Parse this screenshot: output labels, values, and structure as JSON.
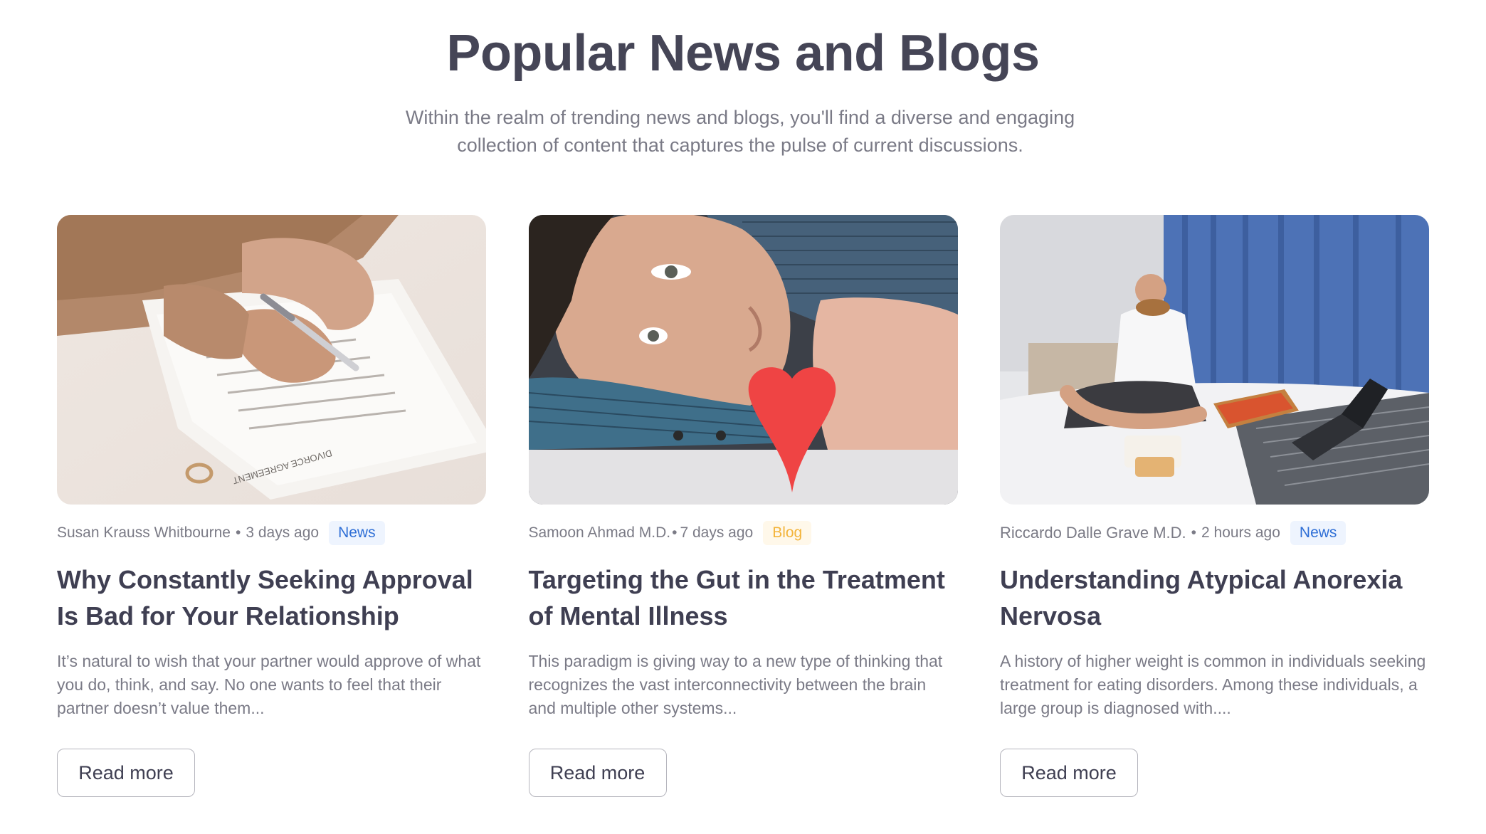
{
  "section": {
    "heading": "Popular News and Blogs",
    "subtitle_line1": "Within the realm of trending news and blogs, you'll find a diverse and engaging",
    "subtitle_line2": "collection of content that captures the pulse of current discussions."
  },
  "cards": [
    {
      "author": "Susan Krauss Whitbourne",
      "separator": "•",
      "time": "3 days ago",
      "category": "News",
      "title": "Why Constantly Seeking Approval Is Bad for Your Relationship",
      "excerpt": "It’s natural to wish that your partner would approve of what you do, think, and say. No one wants to feel that their partner doesn’t value them...",
      "button": "Read more",
      "image_text": "DIVORCE AGREEMENT"
    },
    {
      "author": "Samoon Ahmad M.D.",
      "separator": "•",
      "time": "7 days ago",
      "category": "Blog",
      "title": "Targeting the Gut in the Treatment of Mental Illness",
      "excerpt": "This paradigm is giving way to a new type of thinking that recognizes the vast interconnectivity between the brain and multiple other systems...",
      "button": "Read more"
    },
    {
      "author": "Riccardo Dalle Grave M.D.",
      "separator": "•",
      "time": "2 hours ago",
      "category": "News",
      "title": "Understanding Atypical Anorexia Nervosa",
      "excerpt": "A history of higher weight is common in individuals seeking treatment for eating disorders. Among these individuals, a large group is diagnosed with....",
      "button": "Read more"
    }
  ],
  "colors": {
    "heading": "#454556",
    "muted_text": "#7a7a86",
    "news_badge_bg": "#eef4fe",
    "news_badge_text": "#2f6fd6",
    "blog_badge_bg": "#fff8ea",
    "blog_badge_text": "#f3b43b"
  }
}
